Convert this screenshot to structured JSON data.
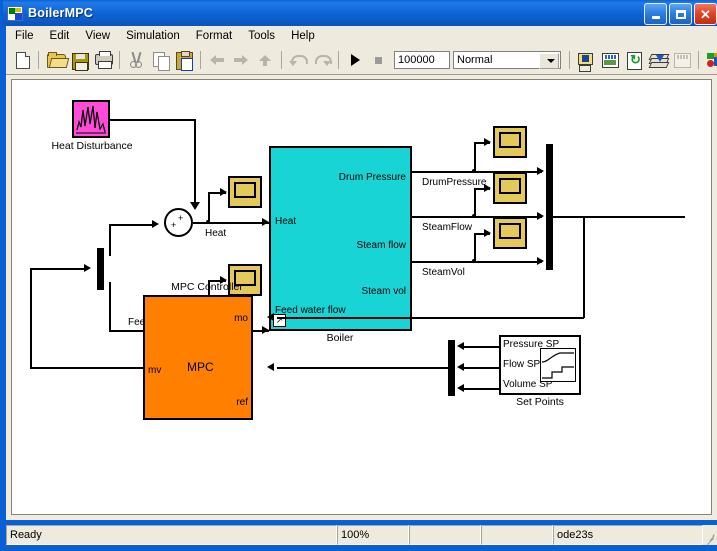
{
  "window": {
    "title": "BoilerMPC",
    "icon": "simulink-icon",
    "minimize_label": "Minimize",
    "maximize_label": "Maximize",
    "close_label": "Close"
  },
  "menu": {
    "items": [
      {
        "label": "File"
      },
      {
        "label": "Edit"
      },
      {
        "label": "View"
      },
      {
        "label": "Simulation"
      },
      {
        "label": "Format"
      },
      {
        "label": "Tools"
      },
      {
        "label": "Help"
      }
    ]
  },
  "toolbar": {
    "icons": [
      "new-model-icon",
      "open-model-icon",
      "save-model-icon",
      "print-icon",
      "cut-icon",
      "copy-icon",
      "paste-icon",
      "back-icon",
      "forward-icon",
      "up-to-parent-icon",
      "undo-icon",
      "redo-icon",
      "start-simulation-icon",
      "stop-simulation-icon"
    ],
    "sim_time": "100000",
    "sim_mode": "Normal",
    "right_icons": [
      "build-model-icon",
      "debugger-icon",
      "update-diagram-icon",
      "library-browser-icon",
      "toggle-grid-icon",
      "model-explorer-icon",
      "model-browser-icon"
    ]
  },
  "diagram": {
    "blocks": [
      {
        "id": "heat_disturbance",
        "label": "Heat Disturbance",
        "type": "signal-builder"
      },
      {
        "id": "sum",
        "label": "",
        "type": "sum",
        "signs": [
          "+",
          "+"
        ]
      },
      {
        "id": "demux_left",
        "label": "",
        "type": "demux"
      },
      {
        "id": "scope_heat",
        "label": "",
        "type": "scope"
      },
      {
        "id": "scope_feedwater",
        "label": "",
        "type": "scope"
      },
      {
        "id": "boiler",
        "label": "Boiler",
        "type": "subsystem"
      },
      {
        "id": "scope_drum_pressure",
        "label": "",
        "type": "scope"
      },
      {
        "id": "scope_steam_flow",
        "label": "",
        "type": "scope"
      },
      {
        "id": "scope_steam_vol",
        "label": "",
        "type": "scope"
      },
      {
        "id": "mux_right",
        "label": "",
        "type": "mux"
      },
      {
        "id": "mpc_controller",
        "label": "MPC Controller",
        "type": "mpc",
        "body_text": "MPC"
      },
      {
        "id": "mux_setpoints",
        "label": "",
        "type": "mux"
      },
      {
        "id": "set_points",
        "label": "Set Points",
        "type": "signal-builder"
      }
    ],
    "boiler": {
      "name": "Boiler",
      "inputs": [
        "Heat",
        "Feed water flow"
      ],
      "outputs": [
        "Drum Pressure",
        "Steam flow",
        "Steam vol"
      ]
    },
    "mpc": {
      "name": "MPC Controller",
      "body_text": "MPC",
      "input_port": "mv",
      "output_ports": [
        "mo",
        "ref"
      ]
    },
    "set_points": {
      "name": "Set Points",
      "signals": [
        "Pressure SP",
        "Flow SP",
        "Volume SP"
      ]
    },
    "signal_labels": [
      {
        "text": "Heat"
      },
      {
        "text": "FeedWater"
      },
      {
        "text": "DrumPressure"
      },
      {
        "text": "SteamFlow"
      },
      {
        "text": "SteamVol"
      }
    ],
    "colors": {
      "boiler": "#19d4d4",
      "mpc": "#ff8000",
      "scope": "#e3c85a",
      "signal_builder": "#ff4bd8",
      "wire": "#000000",
      "canvas": "#ffffff"
    }
  },
  "statusbar": {
    "message": "Ready",
    "zoom": "100%",
    "field_b": "",
    "field_c": "",
    "solver": "ode23s"
  }
}
